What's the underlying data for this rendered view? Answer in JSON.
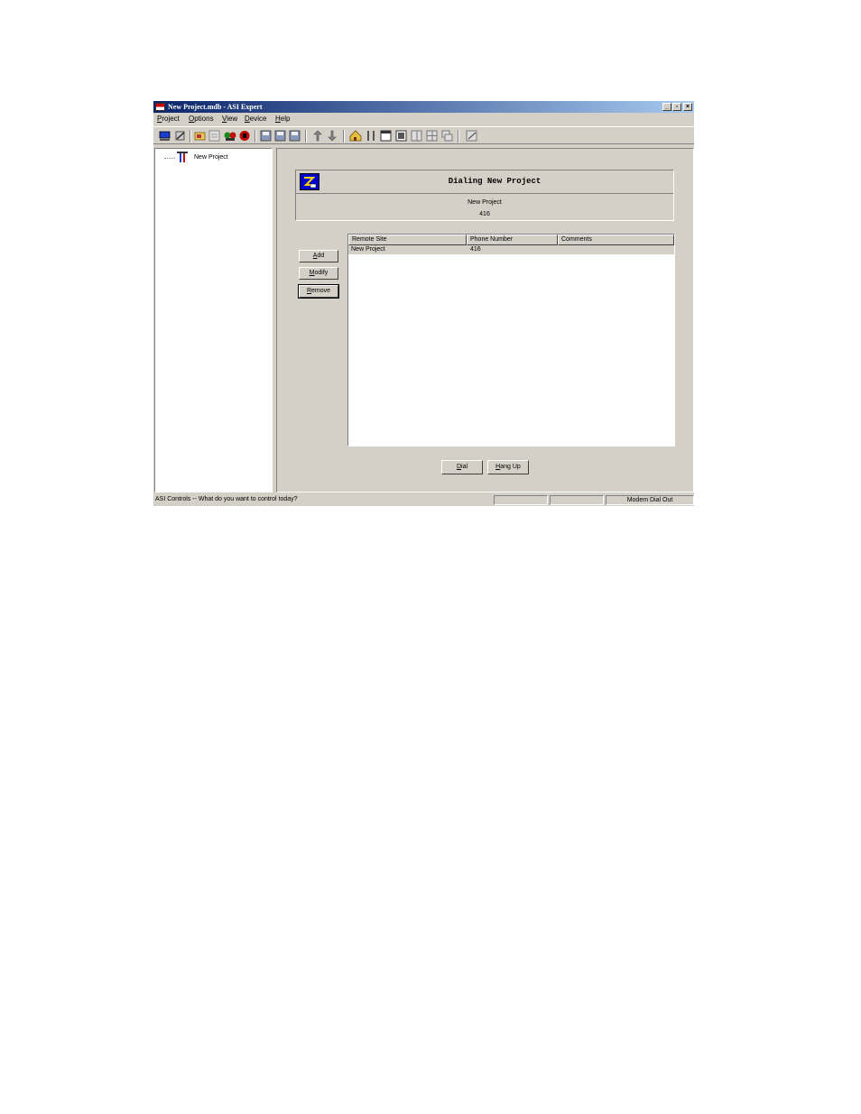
{
  "window": {
    "title": "New Project.mdb - ASI Expert",
    "controls": {
      "minimize": "_",
      "maximize": "▫",
      "close": "×"
    }
  },
  "menu": [
    {
      "first": "P",
      "rest": "roject"
    },
    {
      "first": "O",
      "rest": "ptions"
    },
    {
      "first": "V",
      "rest": "iew"
    },
    {
      "first": "D",
      "rest": "evice"
    },
    {
      "first": "H",
      "rest": "elp"
    }
  ],
  "toolbar": {
    "icons": [
      "connect-icon",
      "disconnect-icon",
      "open-icon",
      "properties-icon",
      "monitor-icon",
      "stop-icon",
      "save-icon",
      "save-all-icon",
      "save-as-icon",
      "upload-icon",
      "download-icon",
      "home-icon",
      "tools-icon",
      "window-icon",
      "page-icon",
      "tile-icon",
      "grid-icon",
      "cascade-icon",
      "help-icon"
    ]
  },
  "tree": {
    "root_label": "New Project"
  },
  "dial": {
    "title": "Dialing New Project",
    "site_name": "New Project",
    "number": "416",
    "buttons": {
      "add": {
        "first": "A",
        "rest": "dd"
      },
      "modify": {
        "first": "M",
        "rest": "odify"
      },
      "remove": {
        "first": "R",
        "rest": "emove"
      },
      "dial": {
        "first": "D",
        "rest": "ial"
      },
      "hangup": {
        "first": "H",
        "rest": "ang Up"
      }
    },
    "columns": [
      "Remote Site",
      "Phone Number",
      "Comments"
    ],
    "rows": [
      {
        "site": "New Project",
        "phone": "416",
        "comments": ""
      }
    ]
  },
  "status": {
    "message": "ASI Controls -- What do you want to control today?",
    "pane2": "",
    "pane3": "",
    "mode": "Modem Dial Out"
  },
  "colors": {
    "title_gradient_start": "#0a246a",
    "title_gradient_end": "#a6caf0",
    "face": "#d4d0c8"
  }
}
